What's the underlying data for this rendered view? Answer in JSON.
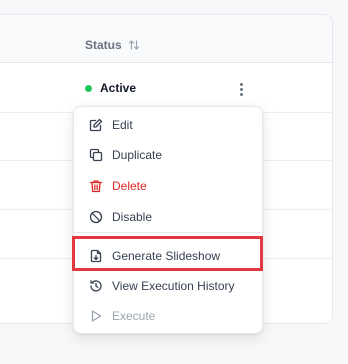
{
  "table": {
    "status_header": "Status",
    "sort_icon": "sort-arrows-icon",
    "row": {
      "status_label": "Active",
      "status_color": "#22c55e"
    }
  },
  "menu": {
    "items": [
      {
        "label": "Edit",
        "icon": "edit-icon"
      },
      {
        "label": "Duplicate",
        "icon": "copy-icon"
      },
      {
        "label": "Delete",
        "icon": "trash-icon",
        "color": "#dc2626"
      },
      {
        "label": "Disable",
        "icon": "ban-icon"
      },
      {
        "label": "Generate Slideshow",
        "icon": "file-download-icon",
        "highlighted": true,
        "highlight_color": "#e0383e"
      },
      {
        "label": "View Execution History",
        "icon": "history-icon"
      },
      {
        "label": "Execute",
        "icon": "play-icon",
        "disabled": true
      }
    ]
  }
}
